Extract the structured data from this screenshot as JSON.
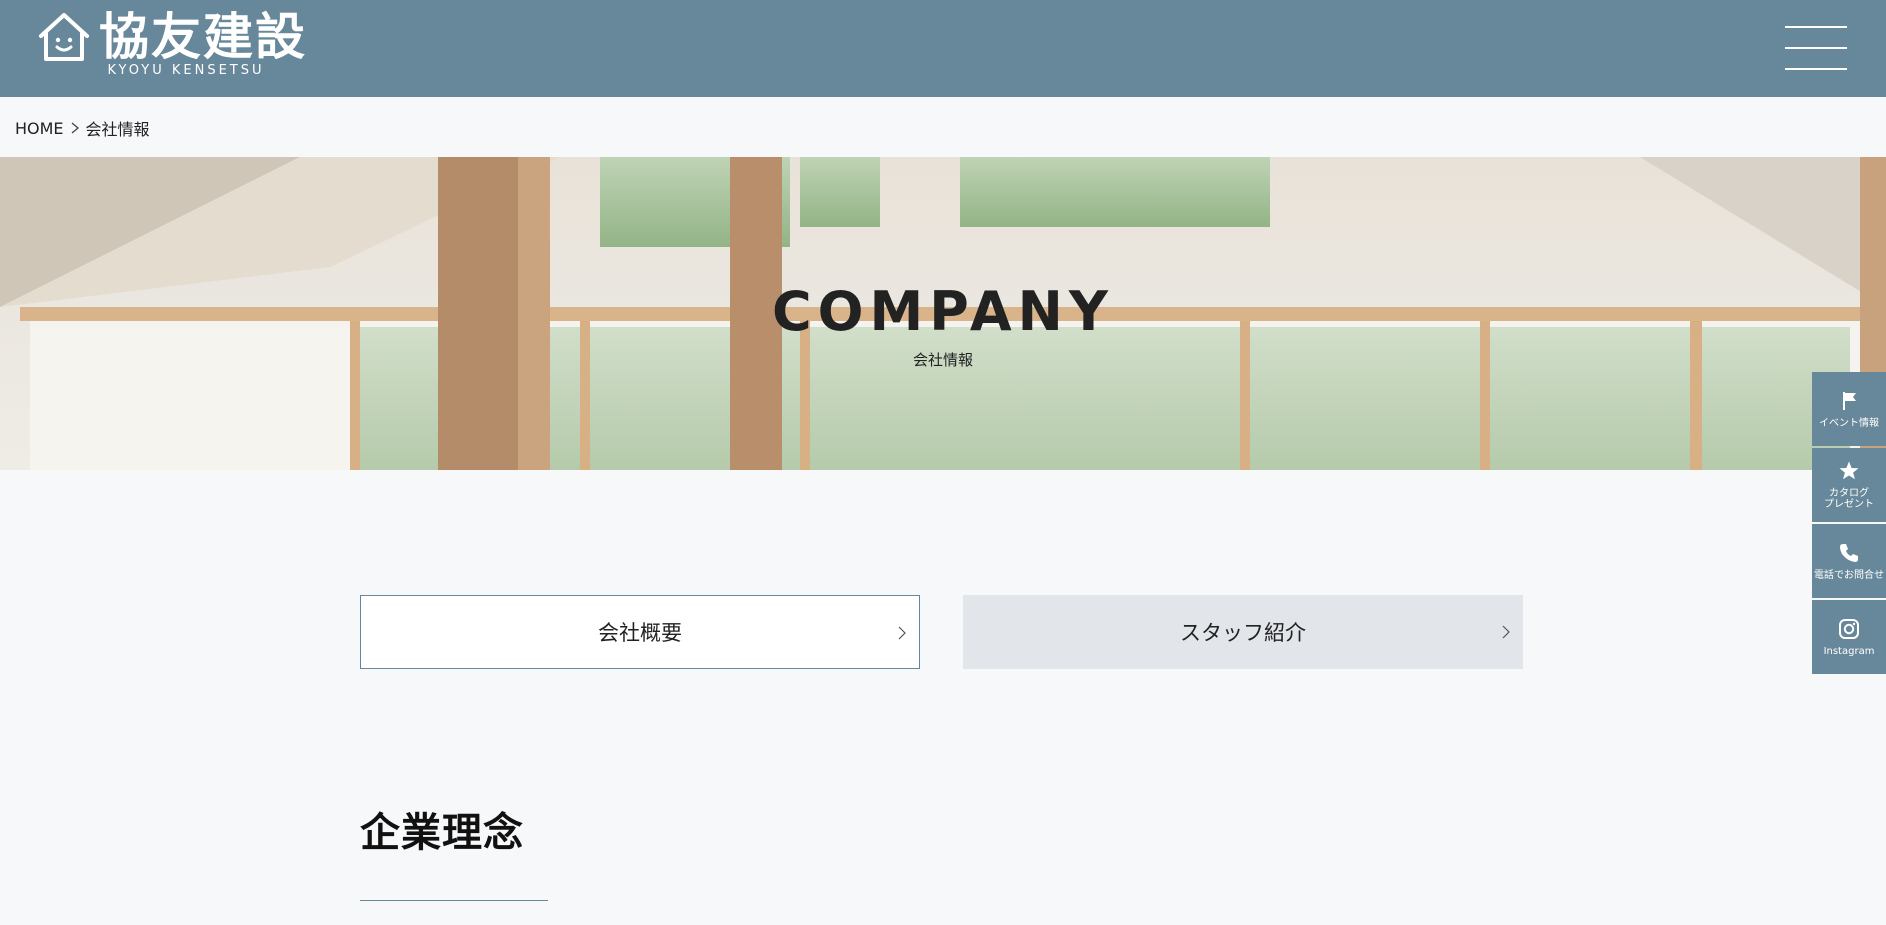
{
  "header": {
    "logo_text": "協友建設",
    "logo_sub": "KYOYU KENSETSU",
    "menu_icon": "hamburger-icon"
  },
  "breadcrumb": {
    "home": "HOME",
    "separator_icon": "chevron-right-icon",
    "current": "会社情報"
  },
  "hero": {
    "title": "COMPANY",
    "subtitle": "会社情報"
  },
  "tabs": [
    {
      "label": "会社概要",
      "icon": "chevron-right-icon"
    },
    {
      "label": "スタッフ紹介",
      "icon": "chevron-right-icon"
    }
  ],
  "section": {
    "title": "企業理念"
  },
  "side_nav": [
    {
      "label": "イベント情報",
      "icon": "flag-icon"
    },
    {
      "label": "カタログ\nプレゼント",
      "icon": "star-icon"
    },
    {
      "label": "電話でお問合せ",
      "icon": "phone-icon"
    },
    {
      "label": "Instagram",
      "icon": "instagram-icon"
    }
  ],
  "colors": {
    "brand": "#67889a",
    "background": "#f7f8fa",
    "tab_inactive": "#e2e6ea"
  }
}
